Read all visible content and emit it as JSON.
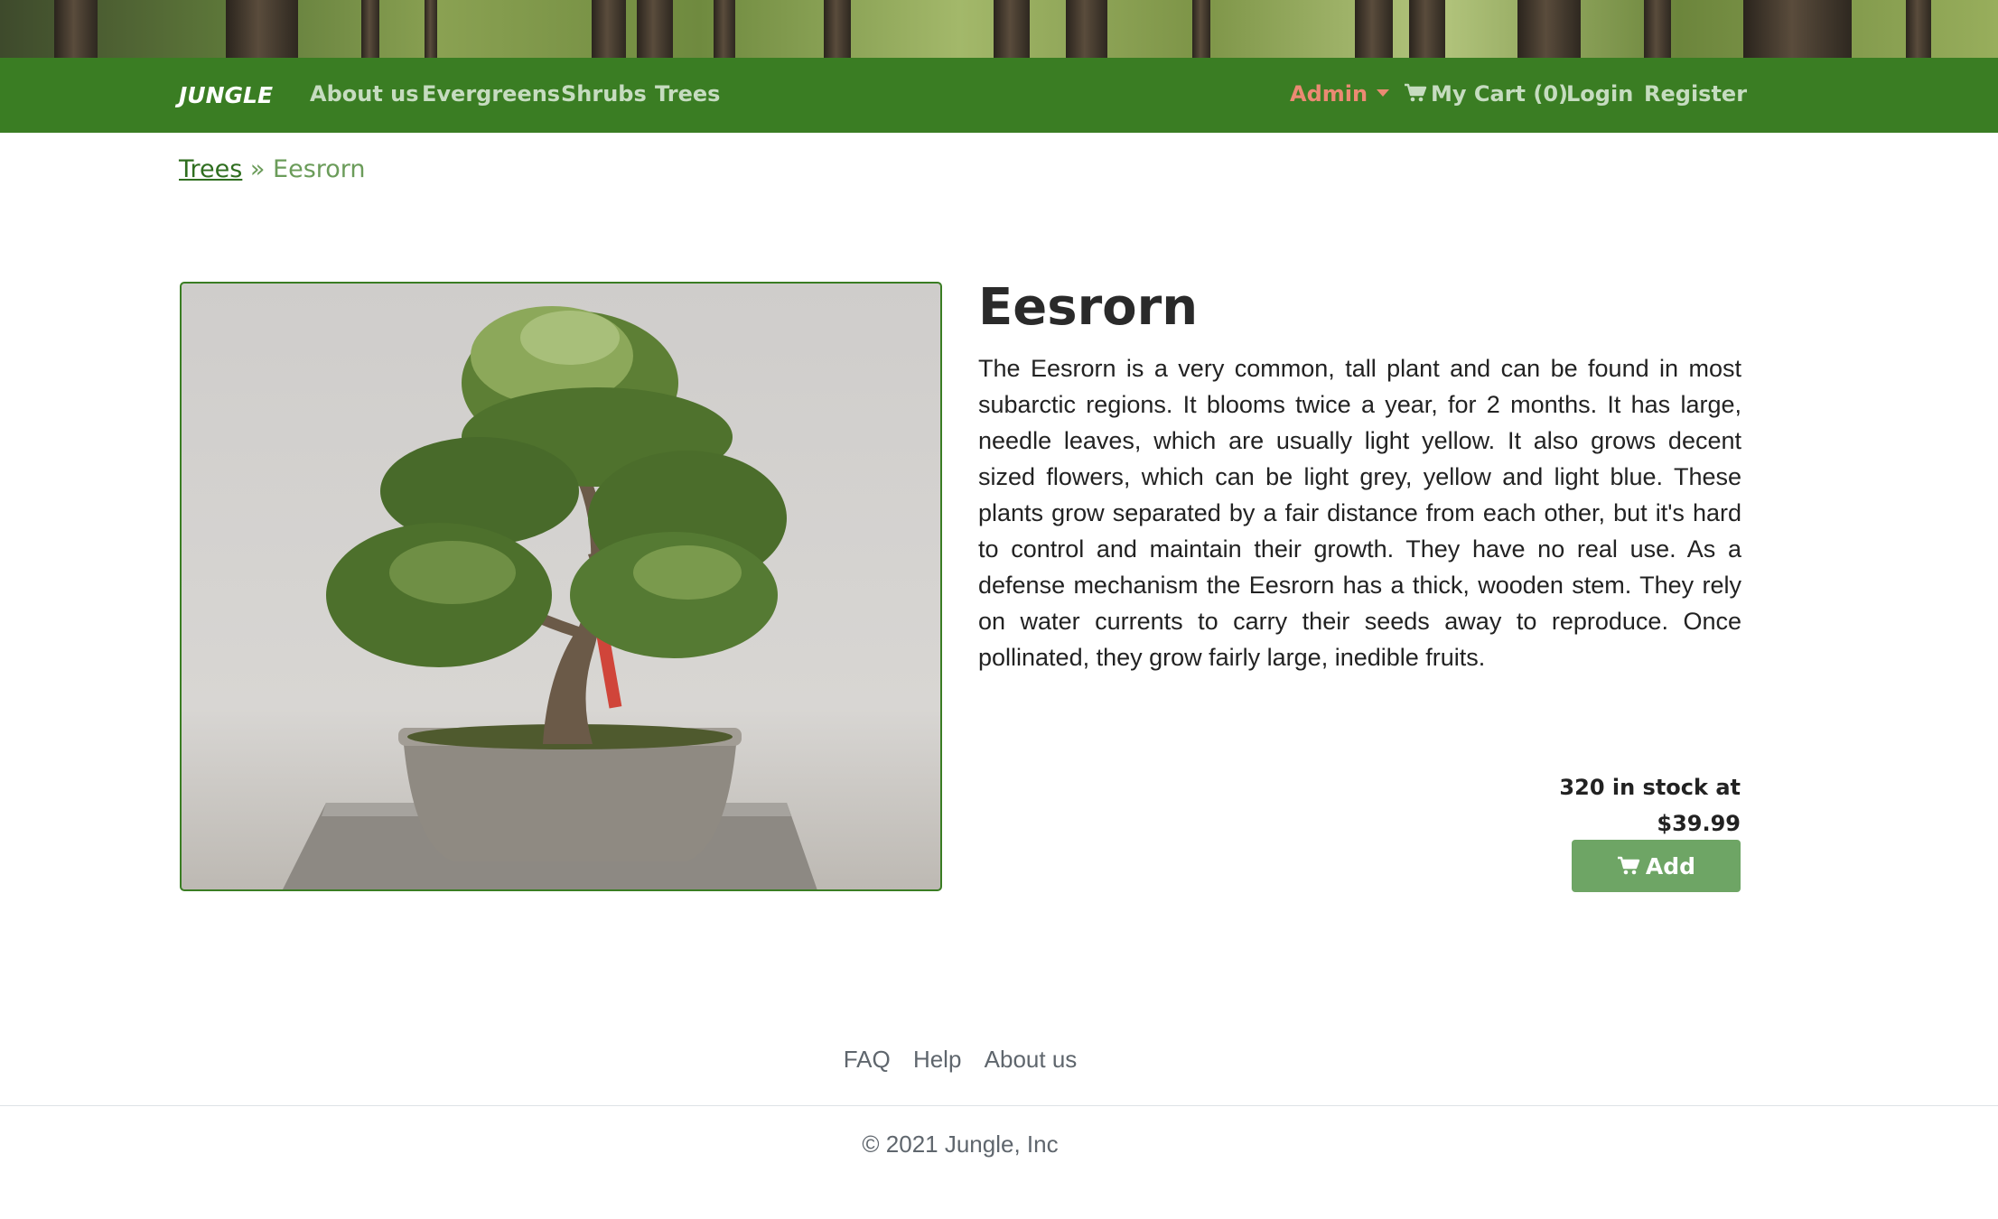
{
  "nav": {
    "brand": "JUNGLE",
    "links": [
      "About us",
      "Evergreens",
      "Shrubs",
      "Trees"
    ],
    "admin_label": "Admin",
    "cart_label": "My Cart (0)",
    "login_label": "Login",
    "register_label": "Register"
  },
  "breadcrumb": {
    "parent": "Trees",
    "separator": "»",
    "current": "Eesrorn"
  },
  "product": {
    "name": "Eesrorn",
    "description": "The Eesrorn is a very common, tall plant and can be found in most subarctic regions. It blooms twice a year, for 2 months. It has large, needle leaves, which are usually light yellow. It also grows decent sized flowers, which can be light grey, yellow and light blue. These plants grow separated by a fair distance from each other, but it's hard to control and maintain their growth. They have no real use. As a defense mechanism the Eesrorn has a thick, wooden stem. They rely on water currents to carry their seeds away to reproduce. Once pollinated, they grow fairly large, inedible fruits.",
    "stock_line": "320 in stock at",
    "price": "$39.99",
    "add_label": "Add"
  },
  "footer": {
    "links": [
      "FAQ",
      "Help",
      "About us"
    ],
    "copyright": "© 2021 Jungle, Inc"
  },
  "colors": {
    "navbar": "#3a7d23",
    "accent_admin": "#eb8a73",
    "add_button": "#6ea565"
  },
  "icons": [
    "cart-icon",
    "caret-down-icon"
  ]
}
